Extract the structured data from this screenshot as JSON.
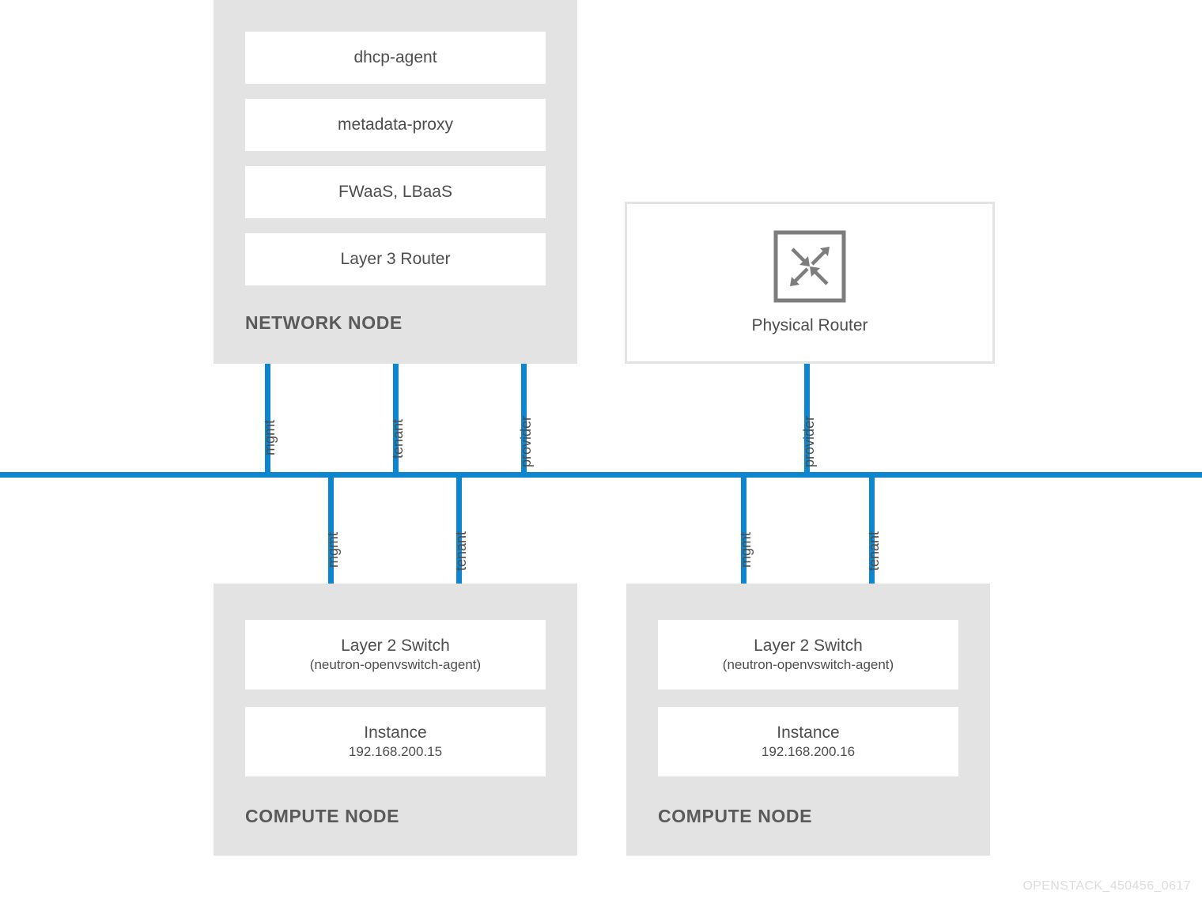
{
  "diagram": {
    "watermark": "OPENSTACK_450456_0617",
    "colors": {
      "network_blue": "#0d86cf",
      "panel_gray": "#e3e3e3",
      "text_gray": "#4d4d4d",
      "title_gray": "#5a5a5a",
      "watermark_gray": "#dcdcdc"
    }
  },
  "network_node": {
    "title": "NETWORK NODE",
    "services": [
      {
        "name": "dhcp-agent"
      },
      {
        "name": "metadata-proxy"
      },
      {
        "name": "FWaaS, LBaaS"
      },
      {
        "name": "Layer 3 Router"
      }
    ],
    "uplinks": [
      {
        "label": "mgmt"
      },
      {
        "label": "tenant"
      },
      {
        "label": "provider"
      }
    ]
  },
  "physical_router": {
    "caption": "Physical Router",
    "icon": "router-icon",
    "uplinks": [
      {
        "label": "provider"
      }
    ]
  },
  "compute_nodes": [
    {
      "title": "COMPUTE NODE",
      "switch_name": "Layer 2 Switch",
      "switch_agent": "(neutron-openvswitch-agent)",
      "instance_name": "Instance",
      "instance_ip": "192.168.200.15",
      "uplinks": [
        {
          "label": "mgmt"
        },
        {
          "label": "tenant"
        }
      ]
    },
    {
      "title": "COMPUTE NODE",
      "switch_name": "Layer 2 Switch",
      "switch_agent": "(neutron-openvswitch-agent)",
      "instance_name": "Instance",
      "instance_ip": "192.168.200.16",
      "uplinks": [
        {
          "label": "mgmt"
        },
        {
          "label": "tenant"
        }
      ]
    }
  ]
}
